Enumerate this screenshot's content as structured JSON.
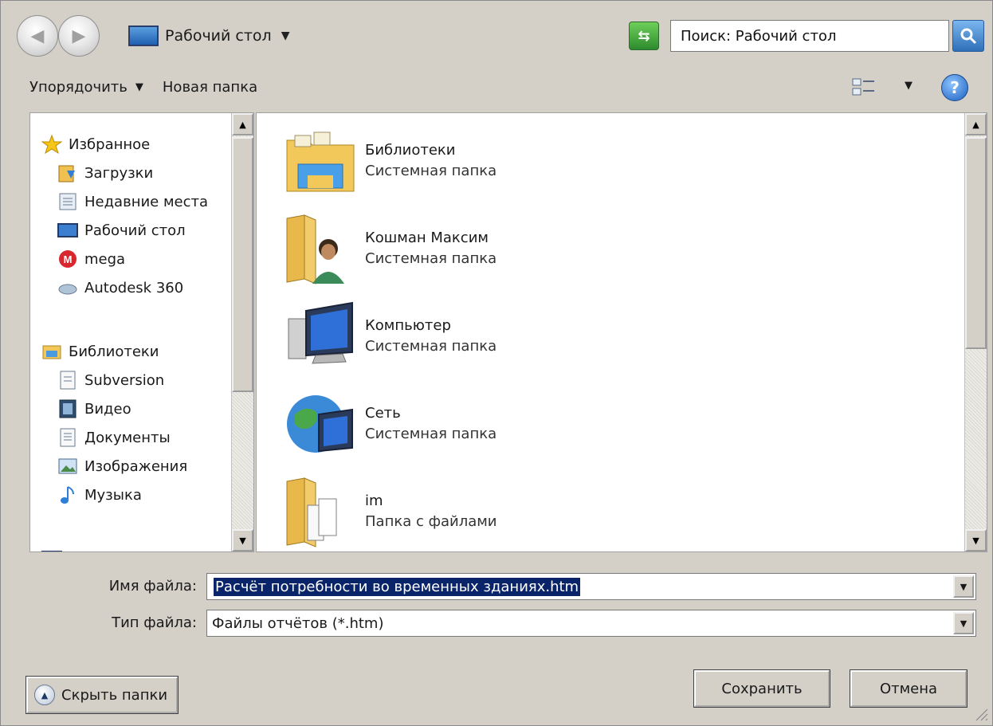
{
  "address": {
    "location": "Рабочий стол",
    "search_placeholder": "Поиск: Рабочий стол"
  },
  "toolbar": {
    "organize": "Упорядочить",
    "new_folder": "Новая папка"
  },
  "nav": {
    "favorites_label": "Избранное",
    "favorites": [
      "Загрузки",
      "Недавние места",
      "Рабочий стол",
      "mega",
      "Autodesk 360"
    ],
    "libraries_label": "Библиотеки",
    "libraries": [
      "Subversion",
      "Видео",
      "Документы",
      "Изображения",
      "Музыка"
    ]
  },
  "files": [
    {
      "name": "Библиотеки",
      "type": "Системная папка",
      "icon": "libraries-folder-icon"
    },
    {
      "name": "Кошман Максим",
      "type": "Системная папка",
      "icon": "user-folder-icon"
    },
    {
      "name": "Компьютер",
      "type": "Системная папка",
      "icon": "computer-icon"
    },
    {
      "name": "Сеть",
      "type": "Системная папка",
      "icon": "network-icon"
    },
    {
      "name": "im",
      "type": "Папка с файлами",
      "icon": "folder-icon"
    }
  ],
  "form": {
    "filename_label": "Имя файла:",
    "filename_value": "Расчёт потребности во временных зданиях.htm",
    "filetype_label": "Тип файла:",
    "filetype_value": "Файлы отчётов (*.htm)"
  },
  "buttons": {
    "hide_folders": "Скрыть папки",
    "save": "Сохранить",
    "cancel": "Отмена"
  },
  "colors": {
    "selection": "#0a246a",
    "dialog_bg": "#d4d0c8"
  }
}
